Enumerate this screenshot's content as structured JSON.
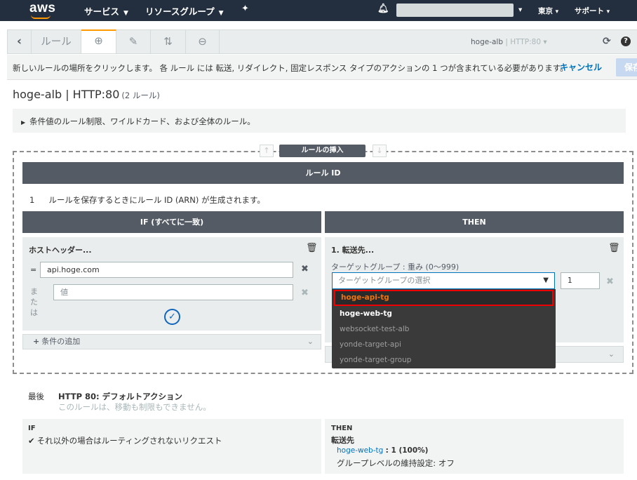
{
  "topnav": {
    "logo": "aws",
    "services": "サービス",
    "resource_groups": "リソースグループ",
    "region": "東京",
    "support": "サポート"
  },
  "toolbar": {
    "rules_label": "ルール",
    "lb_name": "hoge-alb",
    "listener": "HTTP:80"
  },
  "infobar": {
    "message": "新しいルールの場所をクリックします。 各 ルール には 転送, リダイレクト, 固定レスポンス タイプのアクションの 1 つが含まれている必要があります。",
    "cancel": "キャンセル",
    "save": "保存"
  },
  "page": {
    "title": "hoge-alb | HTTP:80",
    "rule_count": "(2 ルール)",
    "collapsible": "条件値のルール制限、ワイルドカード、および全体のルール。"
  },
  "rule_editor": {
    "insert_label": "ルールの挿入",
    "rule_id_header": "ルール ID",
    "rule_num": "1",
    "rule_id_text": "ルールを保存するときにルール ID (ARN) が生成されます。",
    "if_header": "IF (すべてに一致)",
    "then_header": "THEN",
    "if_panel": {
      "title": "ホストヘッダー...",
      "eq": "=",
      "value1": "api.hoge.com",
      "or_label": "または",
      "value2_placeholder": "値",
      "add_condition": "条件の追加"
    },
    "then_panel": {
      "title": "1. 転送先...",
      "target_label": "ターゲットグループ : 重み (0〜999)",
      "select_placeholder": "ターゲットグループの選択",
      "weight": "1",
      "options": [
        "hoge-api-tg",
        "hoge-web-tg",
        "websocket-test-alb",
        "yonde-target-api",
        "yonde-target-group"
      ]
    }
  },
  "default_action": {
    "label": "最後",
    "title": "HTTP 80: デフォルトアクション",
    "subtitle": "このルールは、移動も制限もできません。",
    "if_label": "IF",
    "if_text": "それ以外の場合はルーティングされないリクエスト",
    "then_label": "THEN",
    "then_action": "転送先",
    "tg_name": "hoge-web-tg",
    "tg_weight": ": 1 (100%)",
    "stickiness": "グループレベルの維持設定: オフ"
  },
  "colors": {
    "nav_bg": "#232f3e",
    "accent": "#ff9900",
    "link": "#0073bb",
    "highlight": "#ee0000"
  }
}
